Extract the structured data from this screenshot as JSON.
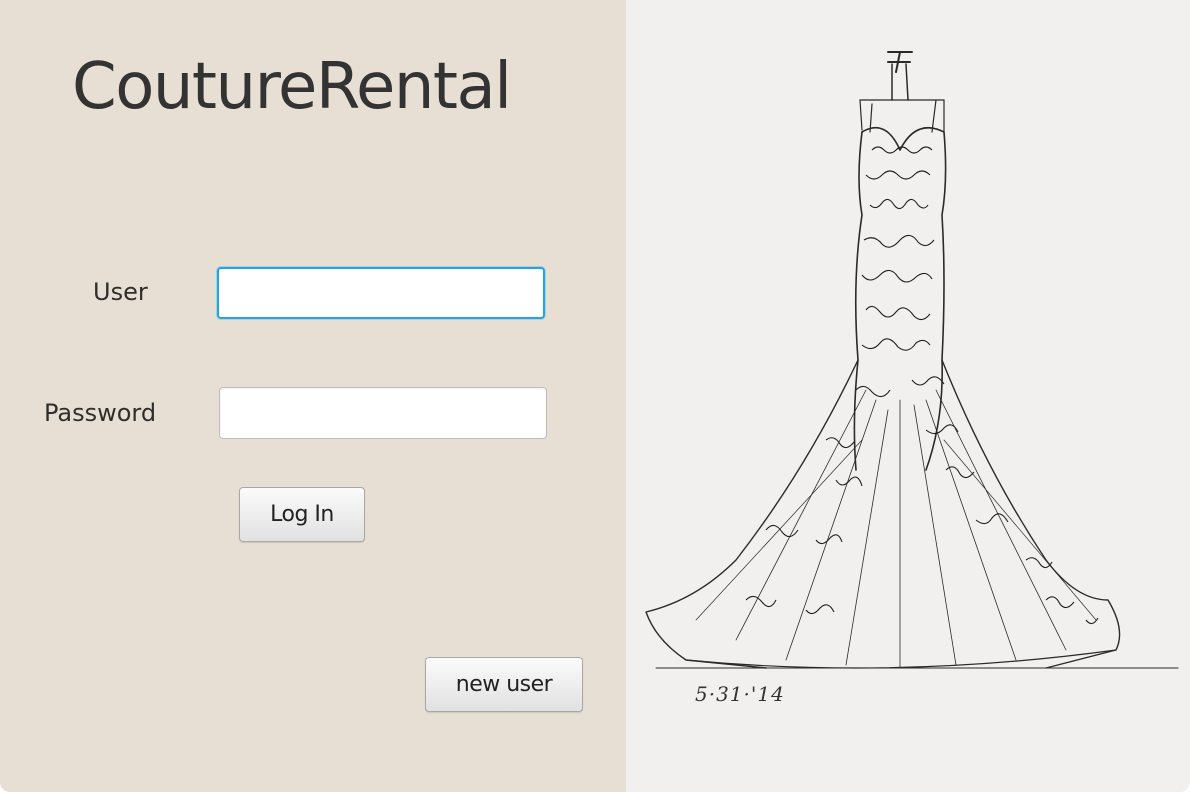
{
  "app": {
    "title": "CoutureRental"
  },
  "login_form": {
    "user_label": "User",
    "user_value": "",
    "password_label": "Password",
    "password_value": "",
    "login_button": "Log In",
    "new_user_button": "new user"
  },
  "illustration": {
    "subject": "wedding-dress-sketch",
    "date_caption": "5·31·'14"
  },
  "colors": {
    "left_panel_bg": "#e8dfd4",
    "right_panel_bg": "#f2f0ee",
    "focus_accent": "#2ba3d6",
    "text": "#333333"
  }
}
